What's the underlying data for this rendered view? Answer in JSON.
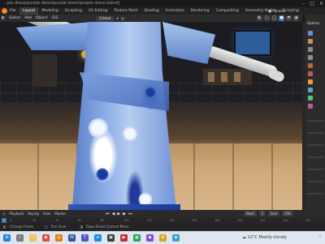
{
  "window": {
    "title": "...ple dress\\purple dress\\purple dress\\purple dress.blend]",
    "controls": [
      "–",
      "□",
      "×"
    ]
  },
  "menubar": {
    "menus": [
      "File",
      "Edit",
      "Render",
      "Window",
      "Help"
    ],
    "workspace_tabs": [
      "Layout",
      "Modeling",
      "Sculpting",
      "UV Editing",
      "Texture Paint",
      "Shading",
      "Animation",
      "Rendering",
      "Compositing",
      "Geometry Nodes",
      "Scripting"
    ],
    "active_tab": "Layout",
    "scene_label": "Scene"
  },
  "viewport_header": {
    "left_items": [
      "Select",
      "Add",
      "Object",
      "GIS"
    ],
    "transform_orientation": "Global",
    "options_label": "Options"
  },
  "timeline": {
    "left_items": [
      "Playback",
      "Keying",
      "View",
      "Marker"
    ],
    "start_label": "Start",
    "start_value": "1",
    "end_label": "End",
    "end_value": "250",
    "ruler_ticks": [
      "0",
      "20",
      "40",
      "60",
      "80",
      "100",
      "120",
      "140",
      "160",
      "180",
      "200",
      "220",
      "240",
      "260"
    ],
    "current_frame": "1"
  },
  "statusbar": {
    "item1": "Change Frame",
    "item2": "Pan View",
    "item3": "Dope Sheet Context Menu"
  },
  "taskbar": {
    "weather_temp": "12°C",
    "weather_text": "Mostly cloudy",
    "icons": [
      "search-icon",
      "file-explorer-icon",
      "chrome-icon",
      "blender-icon",
      "word-icon",
      "teams-icon",
      "edge-icon"
    ]
  },
  "colors": {
    "accent": "#4772b3",
    "blender_orange": "#e87d0d"
  }
}
